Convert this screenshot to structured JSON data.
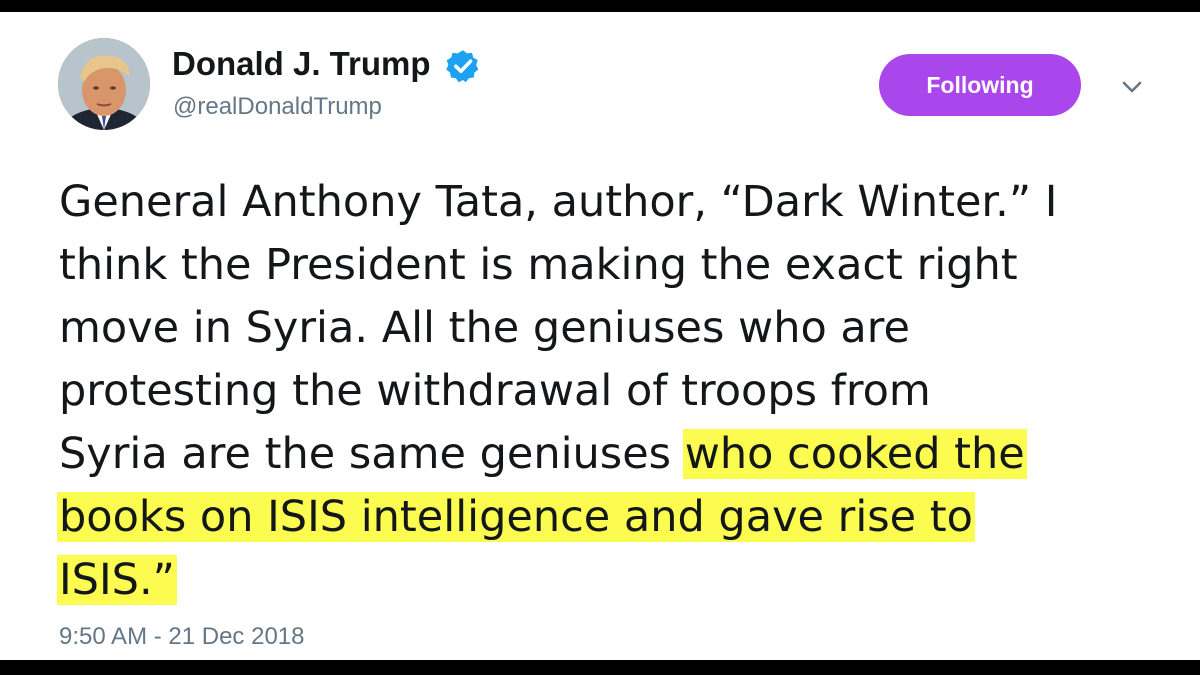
{
  "author": {
    "name": "Donald J. Trump",
    "handle": "@realDonaldTrump",
    "verified": true,
    "avatar_icon": "profile-photo"
  },
  "follow_button": {
    "label": "Following"
  },
  "menu_icon": "chevron-down-icon",
  "tweet": {
    "lines": [
      {
        "plain": "General Anthony Tata, author, “Dark Winter.” I",
        "highlight": ""
      },
      {
        "plain": "think the President is making the exact right",
        "highlight": ""
      },
      {
        "plain": "move in Syria. All the geniuses who are",
        "highlight": ""
      },
      {
        "plain": "protesting the withdrawal of troops from",
        "highlight": ""
      },
      {
        "plain": "Syria are the same geniuses ",
        "highlight": "who cooked the"
      },
      {
        "plain": "",
        "highlight": "books on ISIS intelligence and gave rise to"
      },
      {
        "plain": "",
        "highlight": "ISIS.”"
      }
    ],
    "timestamp": "9:50 AM - 21 Dec 2018"
  },
  "colors": {
    "accent": "#a946ec",
    "highlight": "#fbfb50",
    "text": "#14171a",
    "secondary_text": "#657786",
    "verified": "#1da1f2"
  }
}
